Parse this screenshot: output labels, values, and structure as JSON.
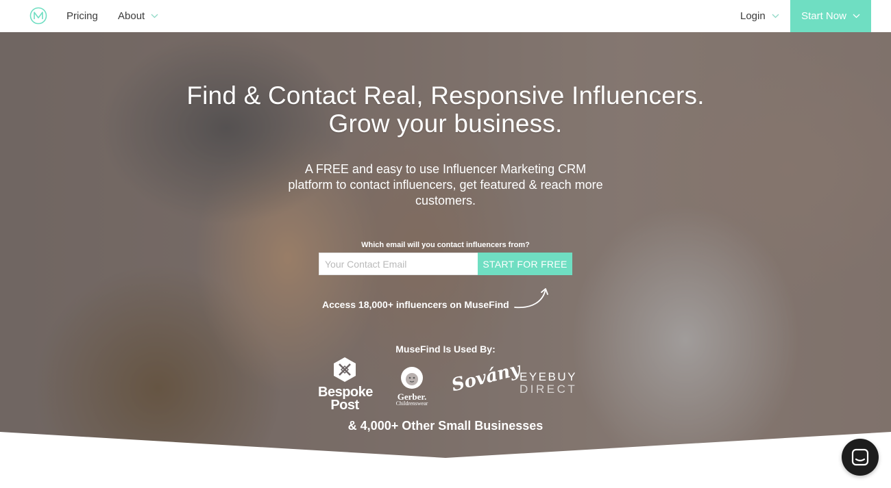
{
  "nav": {
    "pricing": "Pricing",
    "about": "About",
    "login": "Login",
    "start_now": "Start Now"
  },
  "hero": {
    "headline_line1": "Find & Contact Real, Responsive Influencers.",
    "headline_line2": "Grow your business.",
    "subhead": "A FREE and easy to use Influencer Marketing CRM platform to contact influencers, get featured & reach more customers.",
    "email_label": "Which email will you contact influencers from?",
    "email_placeholder": "Your Contact Email",
    "email_value": "",
    "cta": "START FOR FREE",
    "access": "Access 18,000+ influencers on MuseFind",
    "used_by": "MuseFind Is Used By:",
    "others": "& 4,000+ Other Small Businesses"
  },
  "brands": {
    "bespoke": "Bespoke Post",
    "gerber": "Gerber.",
    "gerber_sub": "Childrenswear",
    "sovany": "Sovány",
    "eyebuy_1": "EYEBUY",
    "eyebuy_2": "DIRECT"
  },
  "colors": {
    "accent": "#6fdec2",
    "chat": "#1d1d1d"
  },
  "icons": [
    "musefind-logo-icon",
    "chevron-down-icon",
    "curved-arrow-icon",
    "chat-icon"
  ]
}
